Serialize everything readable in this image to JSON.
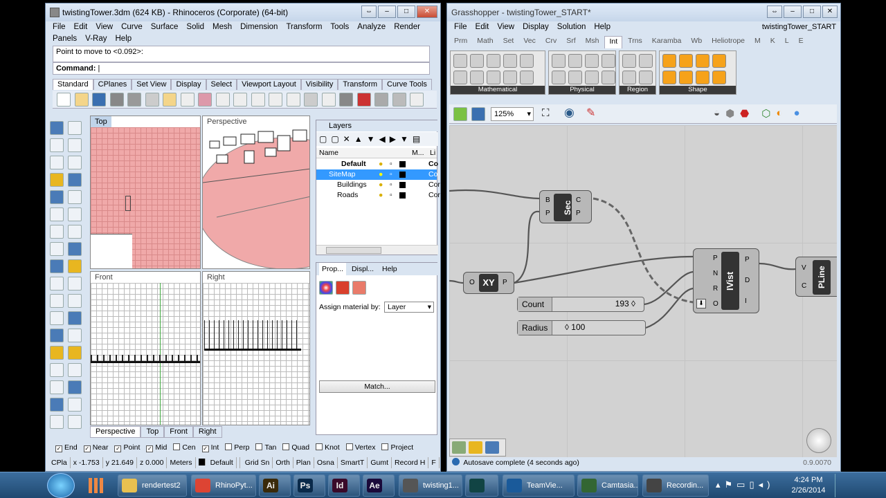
{
  "rhino": {
    "title": "twistingTower.3dm (624 KB) - Rhinoceros (Corporate) (64-bit)",
    "menu": [
      "File",
      "Edit",
      "View",
      "Curve",
      "Surface",
      "Solid",
      "Mesh",
      "Dimension",
      "Transform",
      "Tools",
      "Analyze",
      "Render"
    ],
    "menu2": [
      "Panels",
      "V-Ray",
      "Help"
    ],
    "prompt_text": "Point to move to <0.092>:",
    "command_label": "Command:",
    "toolbar_tabs": [
      "Standard",
      "CPlanes",
      "Set View",
      "Display",
      "Select",
      "Viewport Layout",
      "Visibility",
      "Transform",
      "Curve Tools"
    ],
    "viewports": {
      "top": "Top",
      "perspective": "Perspective",
      "front": "Front",
      "right": "Right"
    },
    "viewport_tabs": [
      "Perspective",
      "Top",
      "Front",
      "Right"
    ],
    "layers": {
      "title": "Layers",
      "col_name": "Name",
      "col_m": "M...",
      "col_li": "Li",
      "rows": [
        {
          "name": "Default",
          "extra": "Co"
        },
        {
          "name": "SiteMap",
          "extra": "Co"
        },
        {
          "name": "Buildings",
          "extra": "Cor"
        },
        {
          "name": "Roads",
          "extra": "Cor"
        }
      ]
    },
    "props": {
      "tabs": [
        "Prop...",
        "Displ...",
        "Help"
      ],
      "assign_label": "Assign material by:",
      "assign_value": "Layer",
      "match_button": "Match..."
    },
    "osnaps": [
      "End",
      "Near",
      "Point",
      "Mid",
      "Cen",
      "Int",
      "Perp",
      "Tan",
      "Quad",
      "Knot",
      "Vertex",
      "Project"
    ],
    "osnaps_checked": [
      true,
      true,
      true,
      true,
      false,
      true,
      false,
      false,
      false,
      false,
      false,
      false
    ],
    "status": {
      "cplane": "CPla",
      "x": "x -1.753",
      "y": "y 21.649",
      "z": "z 0.000",
      "units": "Meters",
      "layer": "Default",
      "items": [
        "Grid Sn",
        "Orth",
        "Plan",
        "Osna",
        "SmartT",
        "Gumt",
        "Record H",
        "F"
      ]
    }
  },
  "gh": {
    "title": "Grasshopper - twistingTower_START*",
    "doc_name": "twistingTower_START",
    "menu": [
      "File",
      "Edit",
      "View",
      "Display",
      "Solution",
      "Help"
    ],
    "tabs": [
      "Prm",
      "Math",
      "Set",
      "Vec",
      "Crv",
      "Srf",
      "Msh",
      "Int",
      "Trns",
      "Karamba",
      "Wb",
      "Heliotrope",
      "M",
      "K",
      "L",
      "E"
    ],
    "active_tab": "Int",
    "groups": [
      "Mathematical",
      "Physical",
      "Region",
      "Shape"
    ],
    "zoom": "125%",
    "components": {
      "sec": {
        "name": "Sec",
        "in": [
          "B",
          "P"
        ],
        "out": [
          "C",
          "P"
        ]
      },
      "xy": {
        "name": "XY",
        "in": [
          "O"
        ],
        "out": [
          "P"
        ]
      },
      "ivist": {
        "name": "IVist",
        "in": [
          "P",
          "N",
          "R",
          "O"
        ],
        "out": [
          "P",
          "D",
          "I"
        ]
      },
      "pline": {
        "name": "PLine",
        "in": [
          "V",
          "C"
        ]
      }
    },
    "sliders": [
      {
        "label": "Count",
        "value": "193 ◊"
      },
      {
        "label": "Radius",
        "value": "◊ 100"
      }
    ],
    "status": "Autosave complete (4 seconds ago)",
    "version": "0.9.0070"
  },
  "taskbar": {
    "items": [
      {
        "label": "rendertest2",
        "color": "#e8c050",
        "glyph": ""
      },
      {
        "label": "RhinoPyt...",
        "color": "#dd4433",
        "glyph": ""
      },
      {
        "label": "",
        "color": "#3a2a0a",
        "glyph": "Ai"
      },
      {
        "label": "",
        "color": "#0a2a4a",
        "glyph": "Ps"
      },
      {
        "label": "",
        "color": "#3a0a2a",
        "glyph": "Id"
      },
      {
        "label": "",
        "color": "#1a0a3a",
        "glyph": "Ae"
      },
      {
        "label": "twisting1...",
        "color": "#555555",
        "glyph": ""
      },
      {
        "label": "",
        "color": "#114444",
        "glyph": ""
      },
      {
        "label": "TeamVie...",
        "color": "#1a5a9a",
        "glyph": ""
      },
      {
        "label": "Camtasia...",
        "color": "#336633",
        "glyph": ""
      },
      {
        "label": "Recordin...",
        "color": "#444444",
        "glyph": ""
      }
    ],
    "time": "4:24 PM",
    "date": "2/26/2014"
  }
}
